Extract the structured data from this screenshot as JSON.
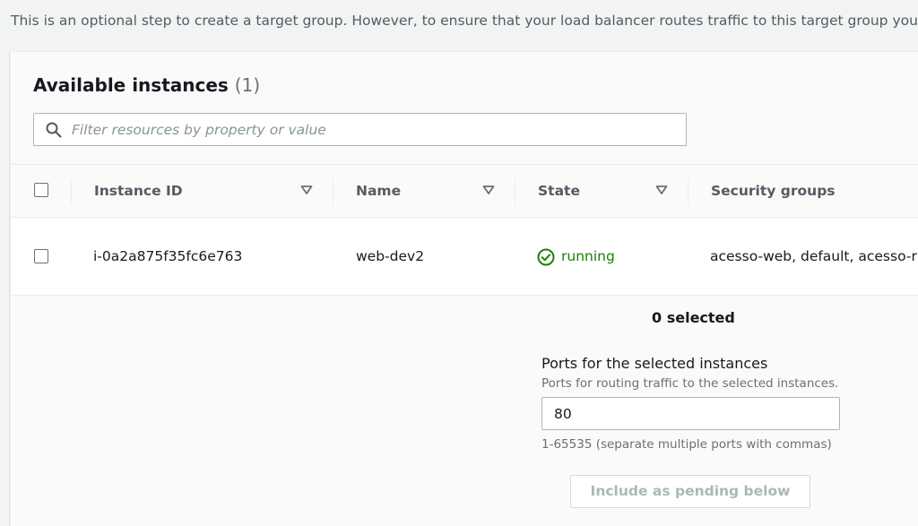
{
  "intro_text": "This is an optional step to create a target group. However, to ensure that your load balancer routes traffic to this target group you",
  "panel": {
    "title": "Available instances",
    "count": "(1)"
  },
  "filter": {
    "placeholder": "Filter resources by property or value",
    "value": ""
  },
  "table": {
    "columns": [
      {
        "label": "Instance ID"
      },
      {
        "label": "Name"
      },
      {
        "label": "State"
      },
      {
        "label": "Security groups"
      }
    ],
    "rows": [
      {
        "instance_id": "i-0a2a875f35fc6e763",
        "name": "web-dev2",
        "state": "running",
        "security_groups": "acesso-web, default, acesso-r"
      }
    ]
  },
  "selection": {
    "summary": "0 selected"
  },
  "ports": {
    "label": "Ports for the selected instances",
    "description": "Ports for routing traffic to the selected instances.",
    "value": "80",
    "constraint": "1-65535 (separate multiple ports with commas)"
  },
  "include_button": {
    "label": "Include as pending below",
    "enabled": false
  },
  "colors": {
    "running": "#1d8102",
    "border": "#aab7b8",
    "muted_text": "#687078"
  },
  "icons": {
    "search": "search-icon",
    "sort": "caret-down-icon",
    "status": "check-circle-icon"
  }
}
